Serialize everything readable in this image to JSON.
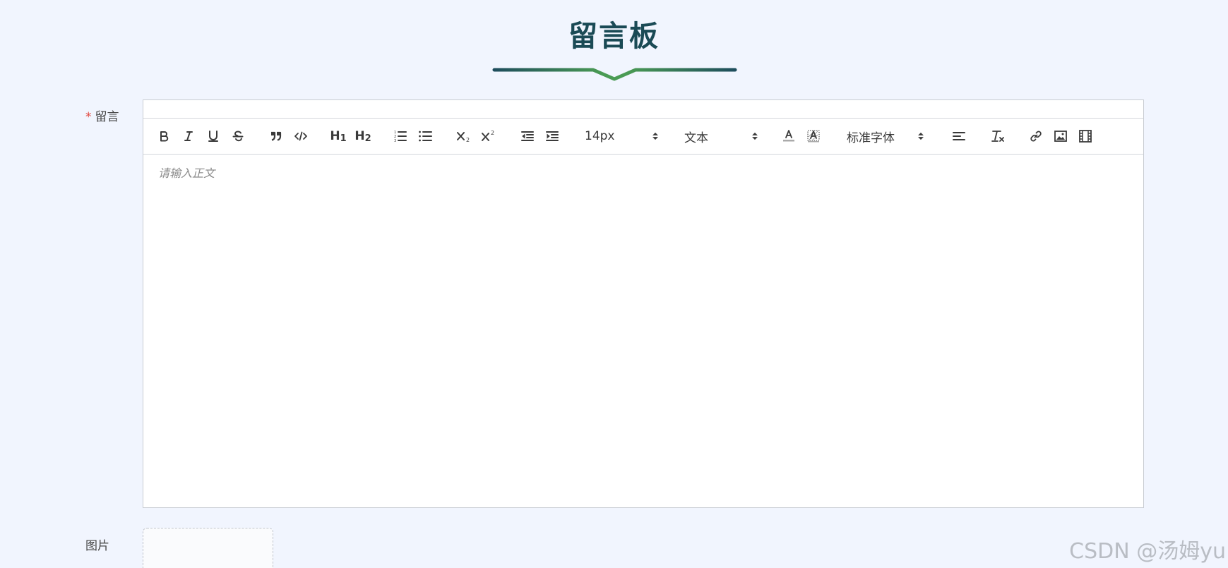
{
  "header": {
    "title": "留言板"
  },
  "form": {
    "message_label": "留言",
    "required_mark": "*",
    "image_label": "图片"
  },
  "editor": {
    "placeholder": "请输入正文",
    "toolbar": {
      "h1": "H",
      "h2": "H",
      "font_size": "14px",
      "header_type": "文本",
      "font_family": "标准字体"
    }
  },
  "watermark": "CSDN @汤姆yu",
  "colors": {
    "title": "#1a4a55",
    "decor_dark": "#1e4d5c",
    "decor_green": "#4a9b54",
    "required": "#e2453c",
    "background": "#f1f5fe"
  }
}
